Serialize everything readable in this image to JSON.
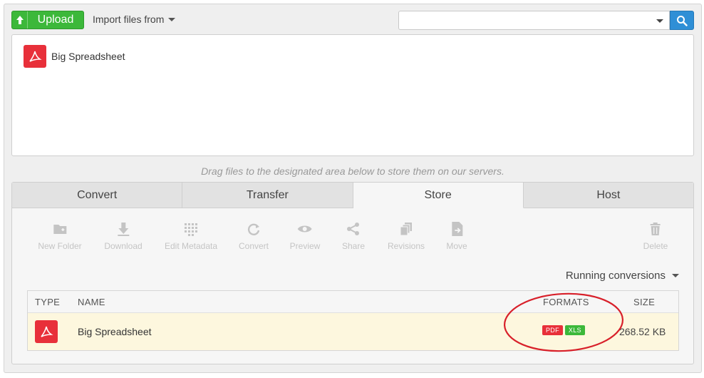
{
  "toolbar_top": {
    "upload_label": "Upload",
    "import_label": "Import files from",
    "search_value": ""
  },
  "drop_area": {
    "file_name": "Big Spreadsheet"
  },
  "hint": "Drag files to the designated area below to store them on our servers.",
  "tabs": [
    {
      "label": "Convert",
      "active": false
    },
    {
      "label": "Transfer",
      "active": false
    },
    {
      "label": "Store",
      "active": true
    },
    {
      "label": "Host",
      "active": false
    }
  ],
  "actions": [
    {
      "label": "New Folder",
      "icon": "new-folder-icon",
      "enabled": false
    },
    {
      "label": "Download",
      "icon": "download-icon",
      "enabled": false
    },
    {
      "label": "Edit Metadata",
      "icon": "edit-metadata-icon",
      "enabled": false
    },
    {
      "label": "Convert",
      "icon": "convert-icon",
      "enabled": false
    },
    {
      "label": "Preview",
      "icon": "eye-icon",
      "enabled": false
    },
    {
      "label": "Share",
      "icon": "share-icon",
      "enabled": false
    },
    {
      "label": "Revisions",
      "icon": "revisions-icon",
      "enabled": false
    },
    {
      "label": "Move",
      "icon": "move-icon",
      "enabled": false
    },
    {
      "label": "Delete",
      "icon": "trash-icon",
      "enabled": false
    }
  ],
  "running_conversions": "Running conversions",
  "table": {
    "headers": {
      "type": "TYPE",
      "name": "NAME",
      "formats": "FORMATS",
      "size": "SIZE"
    },
    "rows": [
      {
        "type_icon": "pdf-icon",
        "name": "Big Spreadsheet",
        "formats": [
          "PDF",
          "XLS"
        ],
        "size": "268.52 KB"
      }
    ]
  },
  "colors": {
    "upload_green": "#3cb83a",
    "search_blue": "#2f8fd6",
    "pdf_red": "#e8303a",
    "row_highlight": "#fdf7de",
    "annotation_red": "#d8202a"
  }
}
